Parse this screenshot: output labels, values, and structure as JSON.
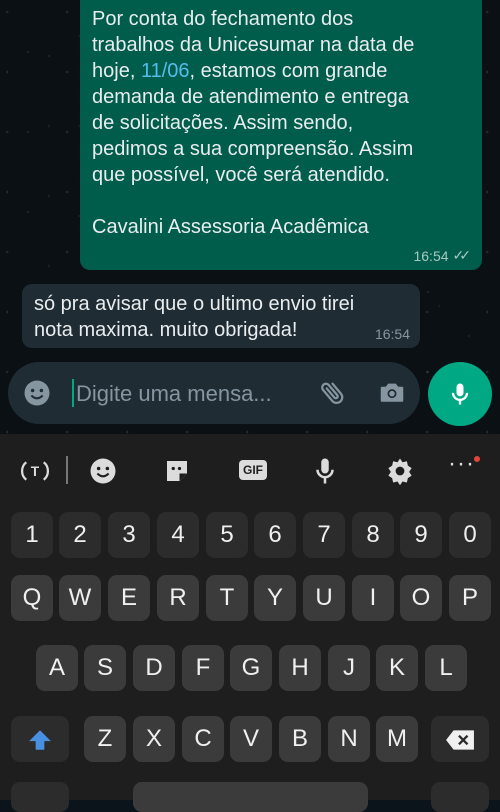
{
  "chat": {
    "outgoing": {
      "text_before": "Por conta do fechamento dos\ntrabalhos da Unicesumar na data de\nhoje, ",
      "date": "11/06",
      "text_after": ", estamos com grande\ndemanda de atendimento e entrega\nde solicitações. Assim sendo,\npedimos a sua compreensão. Assim\nque possível, você será atendido.\n\nCavalini Assessoria Acadêmica",
      "time": "16:54",
      "status_icon": "double-check-icon"
    },
    "incoming": {
      "text": "só pra avisar que o ultimo envio tirei\nnota maxima. muito obrigada!",
      "time": "16:54"
    }
  },
  "composer": {
    "placeholder": "Digite uma mensa...",
    "icons": [
      "emoji-icon",
      "attach-icon",
      "camera-icon",
      "mic-icon"
    ]
  },
  "keyboard": {
    "toolbar_icons": [
      "translate-icon",
      "emoji-icon",
      "sticker-icon",
      "gif-icon",
      "mic-icon",
      "settings-icon",
      "more-icon"
    ],
    "gif_label": "GIF",
    "dots": "···",
    "rows": [
      [
        "1",
        "2",
        "3",
        "4",
        "5",
        "6",
        "7",
        "8",
        "9",
        "0"
      ],
      [
        "Q",
        "W",
        "E",
        "R",
        "T",
        "Y",
        "U",
        "I",
        "O",
        "P"
      ],
      [
        "A",
        "S",
        "D",
        "F",
        "G",
        "H",
        "J",
        "K",
        "L"
      ],
      [
        "shift",
        "Z",
        "X",
        "C",
        "V",
        "B",
        "N",
        "M",
        "backspace"
      ]
    ]
  },
  "colors": {
    "accent": "#00a884",
    "outgoing_bubble": "#005c4b",
    "incoming_bubble": "#1f2c33",
    "link": "#53bdeb"
  }
}
